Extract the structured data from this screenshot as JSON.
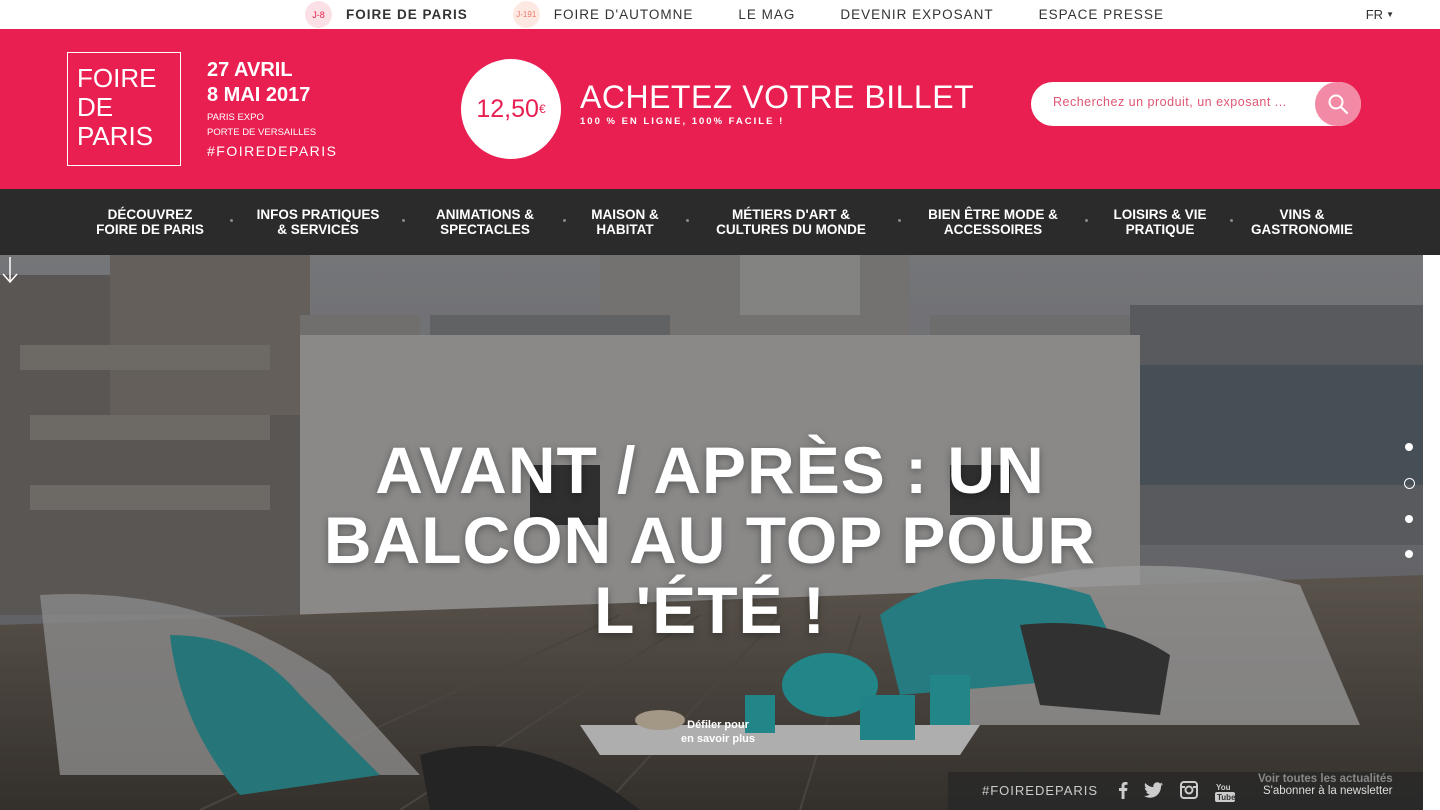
{
  "topbar": {
    "items": [
      {
        "badge": "J-8",
        "label": "FOIRE DE PARIS"
      },
      {
        "badge": "J-191",
        "label": "FOIRE D'AUTOMNE"
      },
      {
        "label": "LE MAG"
      },
      {
        "label": "DEVENIR EXPOSANT"
      },
      {
        "label": "ESPACE PRESSE"
      }
    ],
    "lang": "FR"
  },
  "header": {
    "logo": {
      "line1": "FOIRE",
      "line2": "DE",
      "line3": "PARIS"
    },
    "dates": {
      "start": "27 AVRIL",
      "end": "8 MAI 2017",
      "venue1": "PARIS EXPO",
      "venue2": "PORTE DE VERSAILLES",
      "hashtag": "#FOIREDEPARIS"
    },
    "price": {
      "amount": "12,50",
      "currency": "€"
    },
    "ticket": {
      "title": "ACHETEZ VOTRE BILLET",
      "subtitle": "100 % EN LIGNE, 100% FACILE !"
    },
    "search": {
      "placeholder": "Recherchez un produit, un exposant ..."
    }
  },
  "mainnav": {
    "items": [
      {
        "line1": "DÉCOUVREZ",
        "line2": "FOIRE DE PARIS"
      },
      {
        "line1": "INFOS PRATIQUES",
        "line2": "& SERVICES"
      },
      {
        "line1": "ANIMATIONS &",
        "line2": "SPECTACLES"
      },
      {
        "line1": "MAISON &",
        "line2": "HABITAT"
      },
      {
        "line1": "MÉTIERS D'ART &",
        "line2": "CULTURES DU MONDE"
      },
      {
        "line1": "BIEN ÊTRE MODE &",
        "line2": "ACCESSOIRES"
      },
      {
        "line1": "LOISIRS & VIE",
        "line2": "PRATIQUE"
      },
      {
        "line1": "VINS &",
        "line2": "GASTRONOMIE"
      }
    ]
  },
  "hero": {
    "title_line1": "AVANT / APRÈS : UN",
    "title_line2": "BALCON AU TOP POUR",
    "title_line3": "L'ÉTÉ !",
    "scroll_line1": "Défiler pour",
    "scroll_line2": "en savoir plus",
    "active_slide": 2,
    "slide_count": 4
  },
  "socialbar": {
    "hashtag": "#FOIREDEPARIS",
    "icons": [
      "facebook-icon",
      "twitter-icon",
      "instagram-icon",
      "youtube-icon"
    ],
    "news_link": "Voir toutes les actualités",
    "newsletter_link": "S'abonner à la newsletter"
  },
  "colors": {
    "brand": "#e91f52",
    "nav_bg": "#2b2b2b",
    "search_btn": "#f28aa5"
  }
}
